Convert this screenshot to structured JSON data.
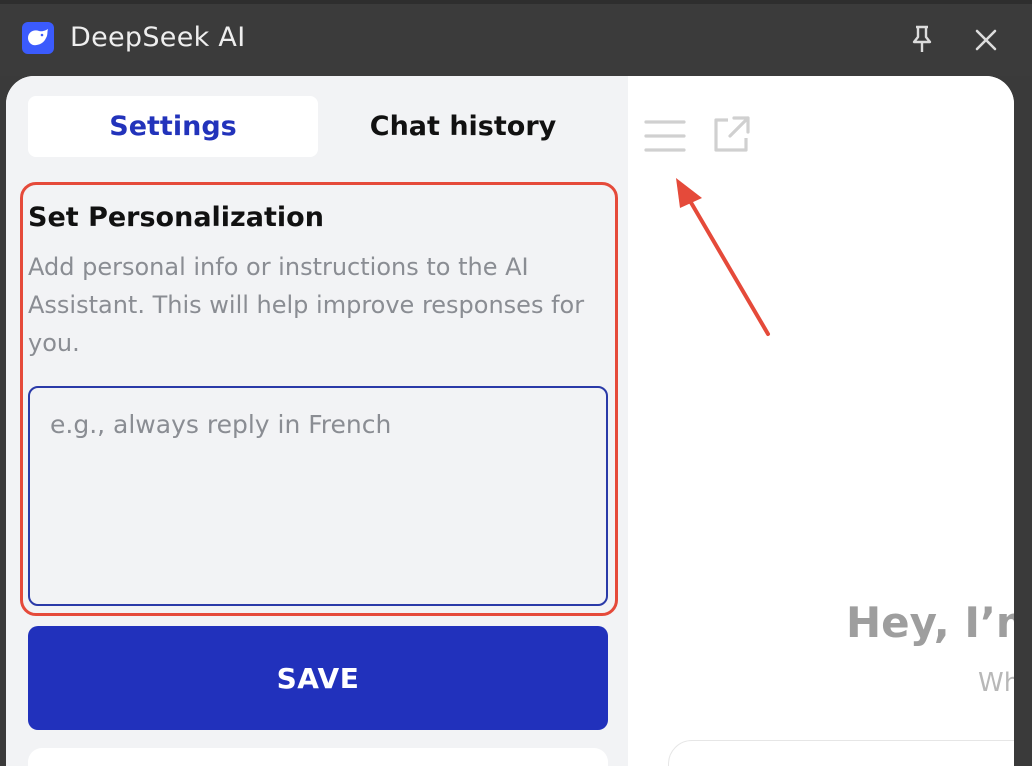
{
  "window": {
    "title": "DeepSeek AI",
    "icons": {
      "logo": "deepseek-whale-logo",
      "pin": "pin-icon",
      "close": "close-icon"
    }
  },
  "tabs": [
    {
      "label": "Settings",
      "active": true
    },
    {
      "label": "Chat history",
      "active": false
    }
  ],
  "personalization": {
    "title": "Set Personalization",
    "description": "Add personal info or instructions to the AI Assistant. This will help improve responses for you.",
    "placeholder": "e.g., always reply in French",
    "value": ""
  },
  "save_label": "SAVE",
  "chat_panel": {
    "icons": {
      "menu": "menu-icon",
      "open_external": "external-link-icon"
    },
    "greeting": "Hey, I’m",
    "subgreeting": "Wh"
  },
  "colors": {
    "accent": "#2131bc",
    "highlight": "#e54a3a",
    "titlebar": "#3b3b3b"
  }
}
